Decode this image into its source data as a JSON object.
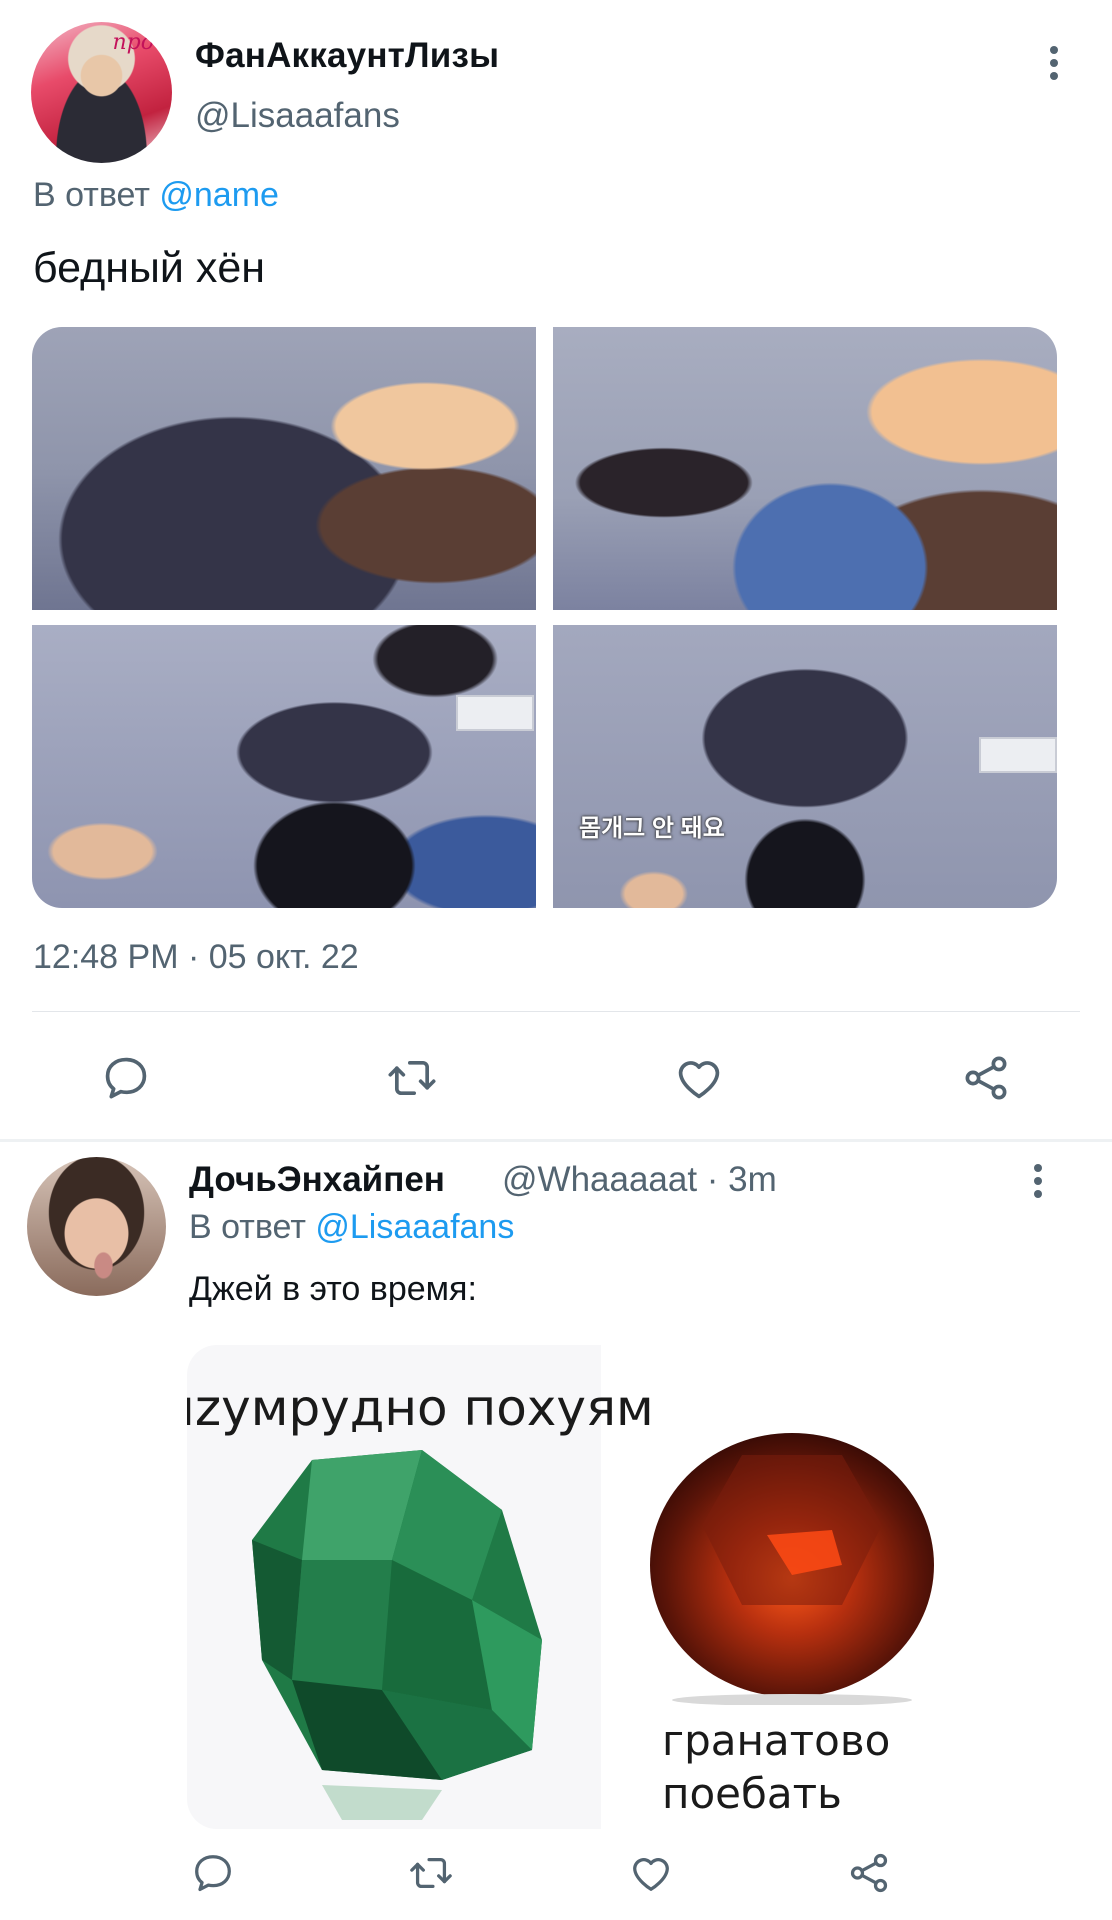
{
  "main_tweet": {
    "display_name": "ФанАккаунтЛизы",
    "handle": "@Lisaaafans",
    "avatar_scribble": "про",
    "reply_prefix": "В ответ",
    "reply_mention": "@name",
    "text": "бедный хён",
    "media_subtitle": "몸개그 안 돼요",
    "timestamp": "12:48 PM · 05 окт. 22",
    "actions": [
      "reply-icon",
      "retweet-icon",
      "like-icon",
      "share-icon"
    ]
  },
  "reply_tweet": {
    "display_name": "ДочьЭнхайпен",
    "handle_time": "@Whaaaaat · 3m",
    "reply_prefix": "В ответ",
    "reply_mention": "@Lisaaafans",
    "text": "Джей в это время:",
    "meme": {
      "top_text": "ızумрудно похуям",
      "bottom_line1": "гранатово",
      "bottom_line2": "поебать"
    },
    "actions": [
      "reply-icon",
      "retweet-icon",
      "like-icon",
      "share-icon"
    ]
  },
  "colors": {
    "accent": "#1d9bf0",
    "secondary_text": "#536471",
    "primary_text": "#0f1419"
  }
}
